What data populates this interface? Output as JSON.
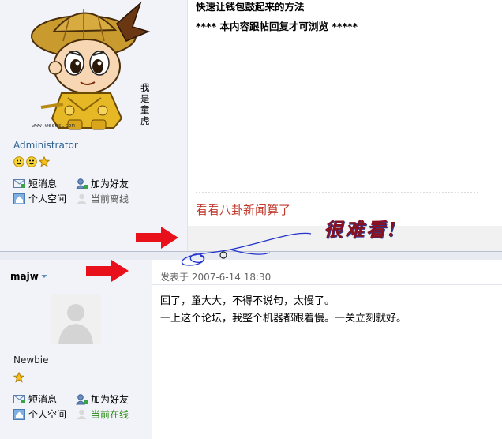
{
  "post1": {
    "avatar_caption": "我是童虎",
    "avatar_watermark": "www.wesos.com",
    "role": "Administrator",
    "rank_icons": [
      "smiley-icon",
      "smiley-icon",
      "star-icon"
    ],
    "actions": {
      "pm_label": "短消息",
      "add_friend_label": "加为好友",
      "space_label": "个人空间",
      "status_label": "当前离线"
    },
    "content_lines": [
      "快速让钱包鼓起来的方法",
      "**** 本内容跟帖回复才可浏览  *****"
    ],
    "signature": "看看八卦新闻算了"
  },
  "annotation": {
    "overlay_text": "很难看!",
    "colors": {
      "arrow": "#e8101a",
      "scribble": "#2233cc"
    }
  },
  "post2": {
    "username": "majw",
    "role": "Newbie",
    "rank_icons": [
      "star-icon"
    ],
    "actions": {
      "pm_label": "短消息",
      "add_friend_label": "加为好友",
      "space_label": "个人空间",
      "status_label": "当前在线"
    },
    "posted_at": "发表于 2007-6-14 18:30",
    "content_lines": [
      "回了，童大大，不得不说句，太慢了。",
      "一上这个论坛，我整个机器都跟着慢。一关立刻就好。"
    ]
  }
}
